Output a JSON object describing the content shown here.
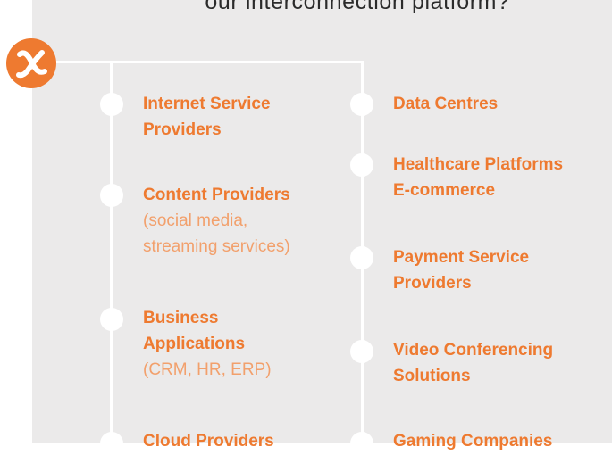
{
  "header": {
    "subtitle": "our interconnection platform?"
  },
  "logo": {
    "glyph": "x"
  },
  "left_column": [
    {
      "title_lines": [
        "Internet Service",
        "Providers"
      ],
      "sub_lines": []
    },
    {
      "title_lines": [
        "Content Providers"
      ],
      "sub_lines": [
        "(social media,",
        "streaming services)"
      ]
    },
    {
      "title_lines": [
        "Business",
        "Applications"
      ],
      "sub_lines": [
        "(CRM, HR, ERP)"
      ]
    },
    {
      "title_lines": [
        "Cloud Providers"
      ],
      "sub_lines": []
    }
  ],
  "right_column": [
    {
      "title_lines": [
        "Data Centres"
      ]
    },
    {
      "title_lines": [
        "Healthcare Platforms",
        "E-commerce"
      ]
    },
    {
      "title_lines": [
        "Payment Service",
        "Providers"
      ]
    },
    {
      "title_lines": [
        "Video Conferencing",
        "Solutions"
      ]
    },
    {
      "title_lines": [
        "Gaming Companies"
      ]
    }
  ],
  "colors": {
    "accent": "#ee7a30",
    "accent_light": "#f2a06c",
    "panel": "#ebeaea",
    "line": "#ffffff"
  }
}
